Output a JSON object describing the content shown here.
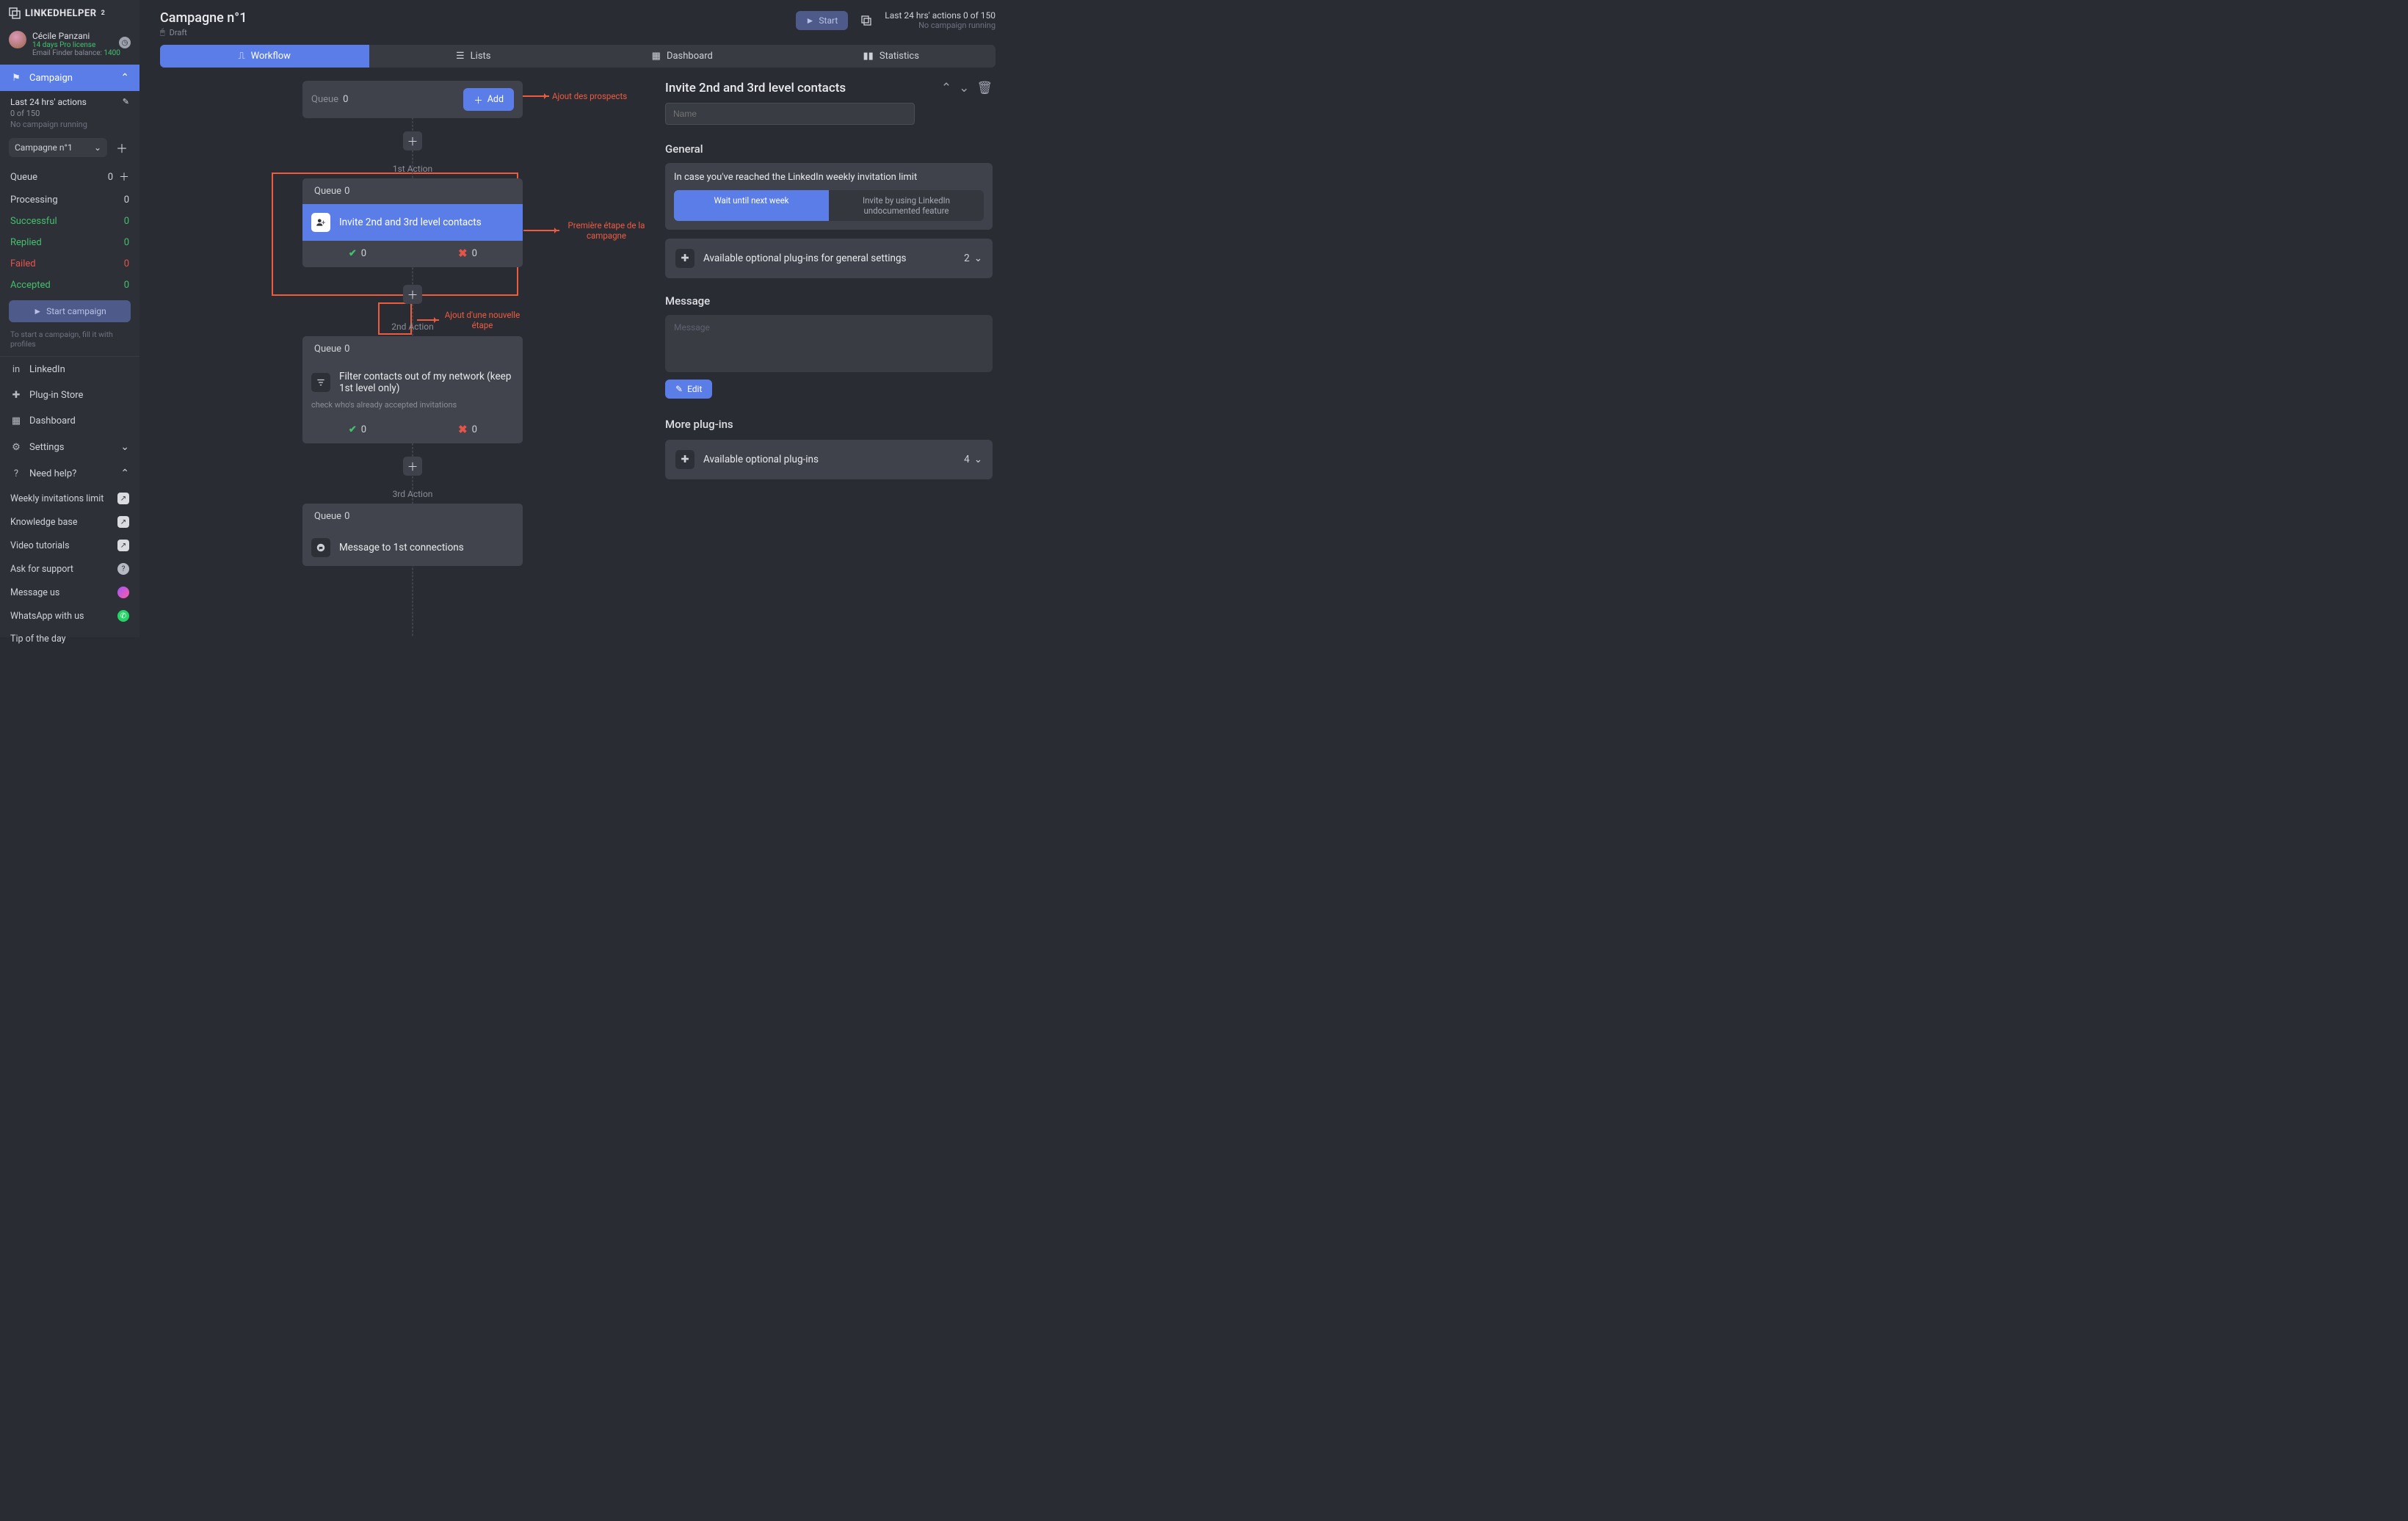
{
  "brand": "LINKEDHELPER",
  "brand_sup": "2",
  "user": {
    "name": "Cécile Panzani",
    "license": "14 days Pro license",
    "balance_label": "Email Finder balance:",
    "balance": "1400"
  },
  "sidebar": {
    "campaign_nav": "Campaign",
    "status_line1": "Last 24 hrs' actions",
    "status_line2": "0 of 150",
    "status_line3": "No campaign running",
    "selected_campaign": "Campagne n°1",
    "stats": [
      {
        "label": "Queue",
        "count": "0",
        "extra": "plus",
        "cls": ""
      },
      {
        "label": "Processing",
        "count": "0",
        "cls": ""
      },
      {
        "label": "Successful",
        "count": "0",
        "cls": "successful"
      },
      {
        "label": "Replied",
        "count": "0",
        "cls": "replied"
      },
      {
        "label": "Failed",
        "count": "0",
        "cls": "failed"
      },
      {
        "label": "Accepted",
        "count": "0",
        "cls": "accepted"
      }
    ],
    "start_btn": "Start campaign",
    "hint": "To start a campaign, fill it with profiles",
    "nav_linkedin": "LinkedIn",
    "nav_plugin": "Plug-in Store",
    "nav_dash": "Dashboard",
    "nav_settings": "Settings",
    "nav_help": "Need help?",
    "help_links": [
      {
        "label": "Weekly invitations limit",
        "trail": "ext"
      },
      {
        "label": "Knowledge base",
        "trail": "ext"
      },
      {
        "label": "Video tutorials",
        "trail": "ext"
      },
      {
        "label": "Ask for support",
        "trail": "q"
      },
      {
        "label": "Message us",
        "trail": "msg"
      },
      {
        "label": "WhatsApp with us",
        "trail": "wa"
      },
      {
        "label": "Tip of the day",
        "trail": ""
      }
    ]
  },
  "top": {
    "title": "Campagne n°1",
    "status": "Draft",
    "start": "Start",
    "stats": "Last 24 hrs' actions 0 of 150",
    "stats_sub": "No campaign running"
  },
  "tabs": {
    "workflow": "Workflow",
    "lists": "Lists",
    "dashboard": "Dashboard",
    "statistics": "Statistics"
  },
  "flow": {
    "queue_label": "Queue",
    "queue_count": "0",
    "add_btn": "Add",
    "ann_add": "Ajout des prospects",
    "ann_first": "Première étape de la campagne",
    "ann_plus": "Ajout d'une nouvelle étape",
    "action1_label": "1st Action",
    "action2_label": "2nd Action",
    "action3_label": "3rd Action",
    "a1_q": "Queue",
    "a1_qn": "0",
    "a1_title": "Invite 2nd and 3rd level contacts",
    "a1_ok": "0",
    "a1_fail": "0",
    "a2_q": "Queue",
    "a2_qn": "0",
    "a2_title": "Filter contacts out of my network (keep 1st level only)",
    "a2_sub": "check who's already accepted invitations",
    "a2_ok": "0",
    "a2_fail": "0",
    "a3_q": "Queue",
    "a3_qn": "0",
    "a3_title": "Message to 1st connections"
  },
  "panel": {
    "title": "Invite 2nd and 3rd level contacts",
    "name_ph": "Name",
    "general": "General",
    "limit_text": "In case you've reached the LinkedIn weekly invitation limit",
    "opt_wait": "Wait until next week",
    "opt_force": "Invite by using LinkedIn undocumented feature",
    "plugins_general": "Available optional plug-ins for general settings",
    "plugins_general_count": "2",
    "message": "Message",
    "message_ph": "Message",
    "edit": "Edit",
    "more": "More plug-ins",
    "plugins_more": "Available optional plug-ins",
    "plugins_more_count": "4"
  }
}
